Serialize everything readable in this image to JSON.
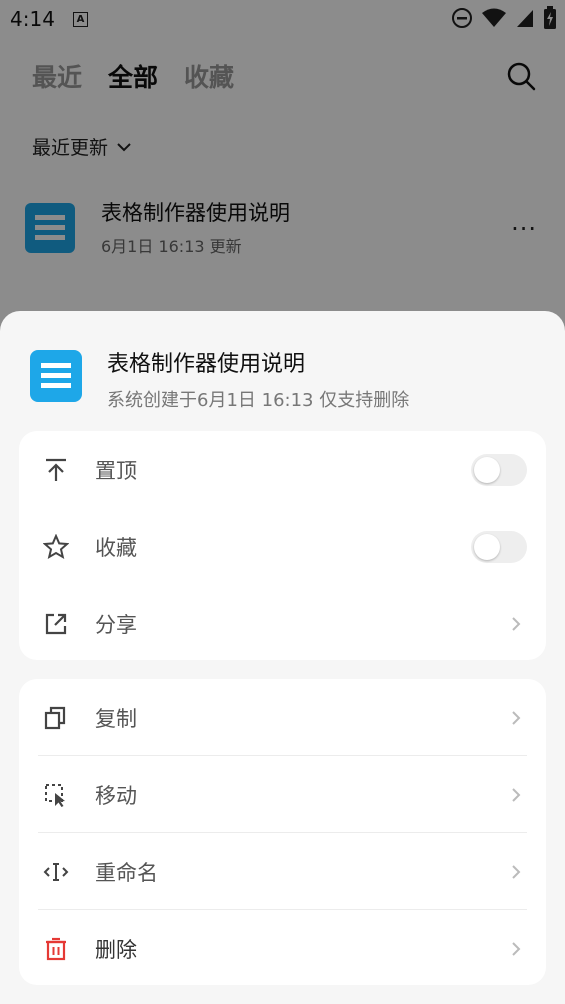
{
  "status_bar": {
    "time": "4:14",
    "a_badge": "A"
  },
  "top_tabs": [
    {
      "label": "最近",
      "active": false
    },
    {
      "label": "全部",
      "active": true
    },
    {
      "label": "收藏",
      "active": false
    }
  ],
  "filter": {
    "label": "最近更新"
  },
  "file": {
    "title": "表格制作器使用说明",
    "meta": "6月1日 16:13 更新",
    "more": "···"
  },
  "sheet": {
    "title": "表格制作器使用说明",
    "subtitle": "系统创建于6月1日 16:13 仅支持删除",
    "group1": [
      {
        "label": "置顶",
        "icon": "pin-top-icon",
        "type": "toggle"
      },
      {
        "label": "收藏",
        "icon": "star-icon",
        "type": "toggle"
      },
      {
        "label": "分享",
        "icon": "share-icon",
        "type": "chevron"
      }
    ],
    "group2": [
      {
        "label": "复制",
        "icon": "copy-icon",
        "type": "chevron"
      },
      {
        "label": "移动",
        "icon": "move-icon",
        "type": "chevron"
      },
      {
        "label": "重命名",
        "icon": "rename-icon",
        "type": "chevron"
      },
      {
        "label": "删除",
        "icon": "trash-icon",
        "type": "chevron"
      }
    ]
  },
  "colors": {
    "accent": "#1ea7e8",
    "danger": "#e53935",
    "sheet_bg": "#f6f6f6"
  }
}
